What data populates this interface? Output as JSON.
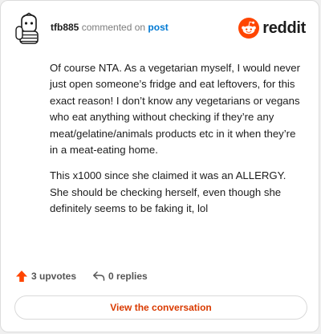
{
  "header": {
    "username": "tfb885",
    "action_text": "commented on",
    "post_link": "post",
    "brand_name": "reddit",
    "avatar_icon": "snoo-avatar-icon",
    "brand_icon": "reddit-logo-icon"
  },
  "comment": {
    "paragraphs": [
      "Of course NTA. As a vegetarian myself, I would never just open someone’s fridge and eat leftovers, for this exact reason! I don’t know any vegetarians or vegans who eat anything without checking if they’re any meat/gelatine/animals products etc in it when they’re in a meat-eating home.",
      "This x1000 since she claimed it was an ALLERGY. She should be checking herself, even though she definitely seems to be faking it, lol"
    ]
  },
  "actions": {
    "upvotes_label": "3 upvotes",
    "replies_label": "0 replies",
    "upvote_icon": "upvote-arrow-icon",
    "reply_icon": "reply-arrow-icon"
  },
  "cta": {
    "label": "View the conversation"
  },
  "colors": {
    "accent": "#d93a00",
    "upvote": "#ff4500",
    "link": "#0079d3",
    "text": "#1c1c1c",
    "muted": "#7c7c7c"
  }
}
